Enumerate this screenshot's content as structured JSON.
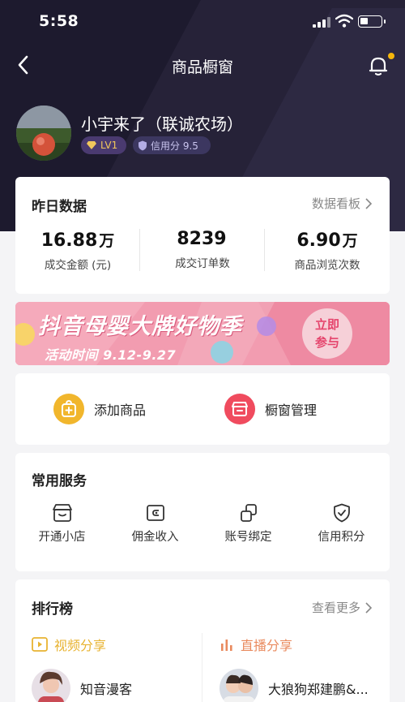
{
  "status_bar": {
    "time": "5:58"
  },
  "nav": {
    "title": "商品橱窗"
  },
  "profile": {
    "name": "小宇来了（联诚农场）",
    "level": "LV1",
    "credit": "信用分 9.5"
  },
  "yesterday": {
    "title": "昨日数据",
    "link": "数据看板",
    "stats": [
      {
        "value": "16.88",
        "unit": "万",
        "label": "成交金额 (元)"
      },
      {
        "value": "8239",
        "unit": "",
        "label": "成交订单数"
      },
      {
        "value": "6.90",
        "unit": "万",
        "label": "商品浏览次数"
      }
    ]
  },
  "banner": {
    "title": "抖音母婴大牌好物季",
    "subtitle": "活动时间 9.12-9.27",
    "button": "立即参与"
  },
  "actions": [
    {
      "label": "添加商品",
      "color": "#f1b62c"
    },
    {
      "label": "橱窗管理",
      "color": "#f04b5e"
    }
  ],
  "services": {
    "title": "常用服务",
    "items": [
      {
        "label": "开通小店",
        "icon": "shop-icon"
      },
      {
        "label": "佣金收入",
        "icon": "wallet-icon"
      },
      {
        "label": "账号绑定",
        "icon": "link-icon"
      },
      {
        "label": "信用积分",
        "icon": "shield-check-icon"
      }
    ]
  },
  "ranking": {
    "title": "排行榜",
    "link": "查看更多",
    "tabs": [
      {
        "label": "视频分享",
        "color": "#e8b331"
      },
      {
        "label": "直播分享",
        "color": "#e98a5e"
      }
    ],
    "items": [
      {
        "name": "知音漫客"
      },
      {
        "name": "大狼狗郑建鹏&..."
      }
    ]
  },
  "colors": {
    "header_bg": "#1d1a2e",
    "accent_gold": "#f1c75c",
    "brand_pink": "#f08ba0"
  }
}
